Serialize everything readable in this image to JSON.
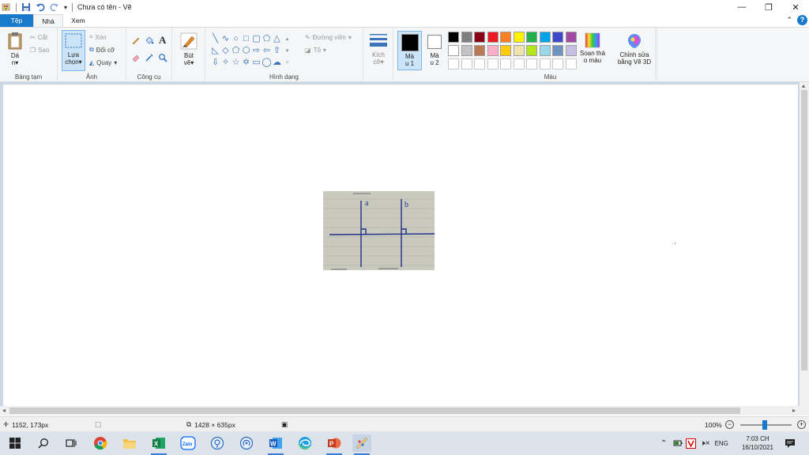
{
  "window": {
    "title": "Chưa có tên - Vẽ",
    "controls": {
      "minimize": "—",
      "maximize": "❐",
      "close": "✕"
    }
  },
  "tabs": [
    {
      "label": "Tệp"
    },
    {
      "label": "Nhà"
    },
    {
      "label": "Xem"
    }
  ],
  "ribbon": {
    "clipboard": {
      "group_label": "Bảng tạm",
      "paste_label": "Dá",
      "paste_sub": "n",
      "cut_label": "Cắt",
      "copy_label": "Sao"
    },
    "image": {
      "group_label": "Ảnh",
      "select_label": "Lựa",
      "select_sub": "chọn",
      "crop_label": "Xén",
      "resize_label": "Đổi cỡ",
      "rotate_label": "Quay"
    },
    "tools": {
      "group_label": "Công cụ"
    },
    "brushes": {
      "label": "Bút",
      "sub": "vẽ"
    },
    "shapes": {
      "group_label": "Hình dạng",
      "outline_label": "Đường viền",
      "fill_label": "Tô"
    },
    "size": {
      "label": "Kích",
      "sub": "cỡ"
    },
    "color1": {
      "label": "Mà",
      "sub": "u 1"
    },
    "color2": {
      "label": "Mà",
      "sub": "u 2"
    },
    "colors": {
      "group_label": "Màu",
      "palette_row1": [
        "#000000",
        "#7f7f7f",
        "#880015",
        "#ed1c24",
        "#ff7f27",
        "#fff200",
        "#22b14c",
        "#00a2e8",
        "#3f48cc",
        "#a349a4"
      ],
      "palette_row2": [
        "#ffffff",
        "#c3c3c3",
        "#b97a57",
        "#ffaec9",
        "#ffc90e",
        "#efe4b0",
        "#b5e61d",
        "#99d9ea",
        "#7092be",
        "#c8bfe7"
      ],
      "edit_colors_label": "Soạn thả",
      "edit_colors_sub": "o màu"
    },
    "paint3d": {
      "label": "Chỉnh sửa",
      "sub": "bằng Vẽ 3D"
    }
  },
  "statusbar": {
    "cursor_pos": "1152, 173px",
    "canvas_size": "1428 × 635px",
    "zoom": "100%"
  },
  "taskbar": {
    "clock_time": "7:03 CH",
    "clock_date": "16/10/2021",
    "language": "ENG"
  },
  "photo_labels": {
    "line_a": "a",
    "line_b": "b"
  }
}
